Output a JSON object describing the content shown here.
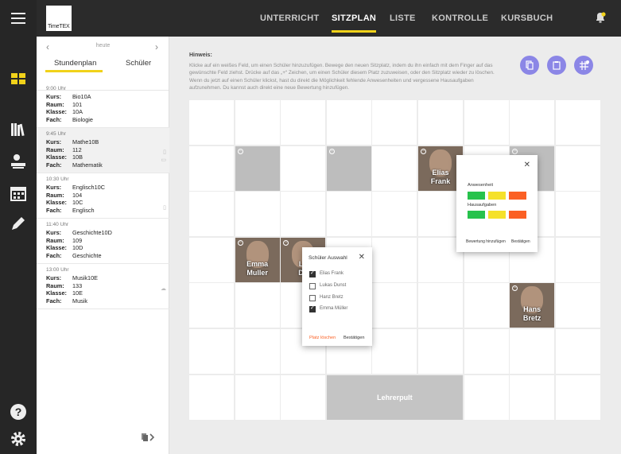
{
  "app": {
    "logo_text": "TimeTEX",
    "nav": [
      "UNTERRICHT",
      "SITZPLAN",
      "LISTE",
      "KONTROLLE",
      "KURSBUCH"
    ],
    "colors": {
      "accent": "#f1d21a",
      "action": "#8b86e6"
    }
  },
  "rail_icons": [
    "menu-icon",
    "dashboard-icon",
    "library-icon",
    "students-icon",
    "calendar-icon",
    "pencil-icon",
    "help-icon",
    "settings-icon"
  ],
  "sidebar": {
    "date_label": "heute",
    "tabs": [
      "Stundenplan",
      "Schüler"
    ],
    "labels": {
      "kurs": "Kurs:",
      "raum": "Raum:",
      "klasse": "Klasse:",
      "fach": "Fach:"
    },
    "lessons": [
      {
        "time": "9:00 Uhr",
        "kurs": "Bio10A",
        "raum": "101",
        "klasse": "10A",
        "fach": "Biologie"
      },
      {
        "time": "9:45 Uhr",
        "kurs": "Mathe10B",
        "raum": "112",
        "klasse": "10B",
        "fach": "Mathematik"
      },
      {
        "time": "10:30 Uhr",
        "kurs": "Englisch10C",
        "raum": "104",
        "klasse": "10C",
        "fach": "Englisch"
      },
      {
        "time": "11:40 Uhr",
        "kurs": "Geschichte10D",
        "raum": "109",
        "klasse": "10D",
        "fach": "Geschichte"
      },
      {
        "time": "13:00 Uhr",
        "kurs": "Musik10E",
        "raum": "133",
        "klasse": "10E",
        "fach": "Musik"
      }
    ]
  },
  "main": {
    "hint_title": "Hinweis:",
    "hint_text": "Klicke auf ein weißes Feld, um einen Schüler hinzuzufügen.  Bewege den neuen Sitzplatz, indem du ihn einfach mit dem Finger auf das gewünschte Feld ziehst. Drücke auf das „+“ Zeichen, um einen Schüler diesem Platz zuzuweisen, oder den Sitzplatz wieder zu löschen. Wenn du jetzt auf einen Schüler klickst, hast du direkt die Möglichkeit fehlende Anwesenheiten und vergessene Hausaufgaben aufzunehmen. Du kannst auch direkt eine neue Bewertung hinzufügen.",
    "students": [
      {
        "first": "Elias",
        "last": "Frank"
      },
      {
        "first": "Emma",
        "last": "Muller"
      },
      {
        "first": "Lu",
        "last": "Du"
      },
      {
        "first": "Hans",
        "last": "Bretz"
      }
    ],
    "teacher_desk": "Lehrerpult"
  },
  "select_popup": {
    "title": "Schüler Auswahl",
    "options": [
      {
        "name": "Elias Frank",
        "checked": true
      },
      {
        "name": "Lukas Dunst",
        "checked": false
      },
      {
        "name": "Hanz Bretz",
        "checked": false
      },
      {
        "name": "Emma Müller",
        "checked": true
      }
    ],
    "delete_label": "Platz löschen",
    "confirm_label": "Bestätigen"
  },
  "rating_popup": {
    "anwesenheit_label": "Anwesenheit",
    "hausaufgaben_label": "Hausaufgaben",
    "add_rating_label": "Bewertung hinzufügen",
    "confirm_label": "Bestätigen",
    "status_colors": [
      "#27c24c",
      "#f5e12a",
      "#fb6024"
    ]
  }
}
